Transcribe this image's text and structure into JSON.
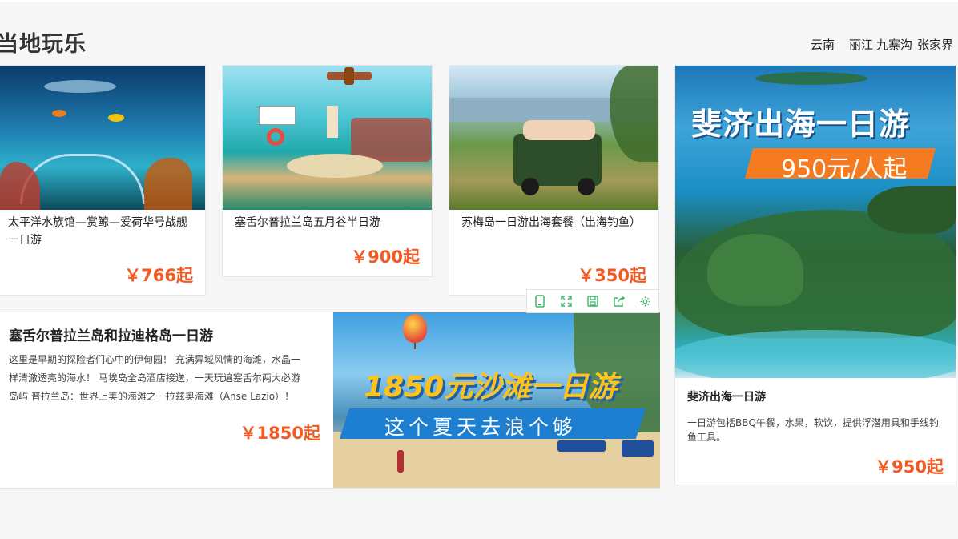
{
  "section": {
    "title": "当地玩乐"
  },
  "tags": [
    "云南",
    "丽江",
    "九寨沟",
    "张家界"
  ],
  "cards": [
    {
      "title": "太平洋水族馆—赏鲸—爱荷华号战舰一日游",
      "price": "￥766起"
    },
    {
      "title": "塞舌尔普拉兰岛五月谷半日游",
      "price": "￥900起"
    },
    {
      "title": "苏梅岛一日游出海套餐（出海钓鱼）",
      "price": "￥350起"
    }
  ],
  "wide_card": {
    "title": "塞舌尔普拉兰岛和拉迪格岛一日游",
    "desc": "这里是早期的探险者们心中的伊甸园！ 充满异域风情的海滩，水晶一样清澈透亮的海水！ 马埃岛全岛酒店接送，一天玩遍塞舌尔两大必游岛屿 普拉兰岛：世界上美的海滩之一拉兹奥海滩（Anse Lazio）！",
    "price": "￥1850起",
    "banner": {
      "headline": "1850元沙滩一日游",
      "sub": "这个夏天去浪个够"
    }
  },
  "right_card": {
    "banner_title": "斐济出海一日游",
    "banner_price": "950元/人起",
    "title": "斐济出海一日游",
    "desc": "一日游包括BBQ午餐，水果，软饮，提供浮潜用具和手线钓鱼工具。",
    "price": "￥950起"
  },
  "toolbar": {
    "icons": [
      "mobile-icon",
      "fullscreen-icon",
      "save-icon",
      "share-icon",
      "settings-icon"
    ]
  },
  "colors": {
    "price": "#f25a24",
    "toolbar_icon": "#3bb56a",
    "banner_orange": "#f67a1f"
  }
}
